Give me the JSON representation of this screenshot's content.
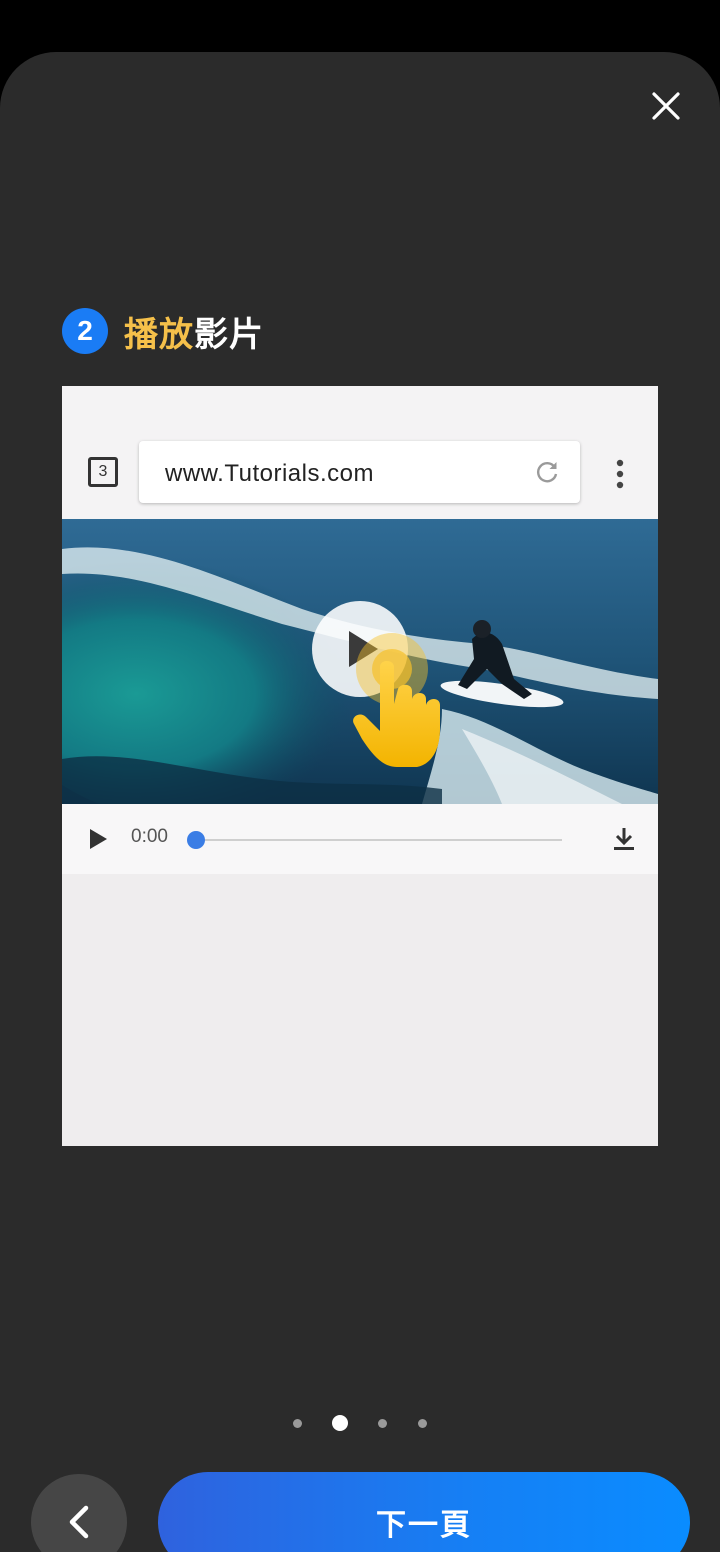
{
  "step": {
    "number": "2",
    "title_highlight": "播放",
    "title_rest": "影片",
    "badge_color": "#1a7cf5",
    "highlight_color": "#f5c04a"
  },
  "illustration": {
    "tab_count": "3",
    "url": "www.Tutorials.com",
    "player": {
      "time": "0:00",
      "progress": 0
    },
    "icons": [
      "reload-icon",
      "more-vert-icon",
      "play-icon",
      "download-icon",
      "tap-hand-icon"
    ]
  },
  "pager": {
    "total": 4,
    "current": 2
  },
  "footer": {
    "next_label": "下一頁",
    "accent": "#1580f5"
  },
  "icons": [
    "close-icon",
    "back-arrow-icon"
  ]
}
